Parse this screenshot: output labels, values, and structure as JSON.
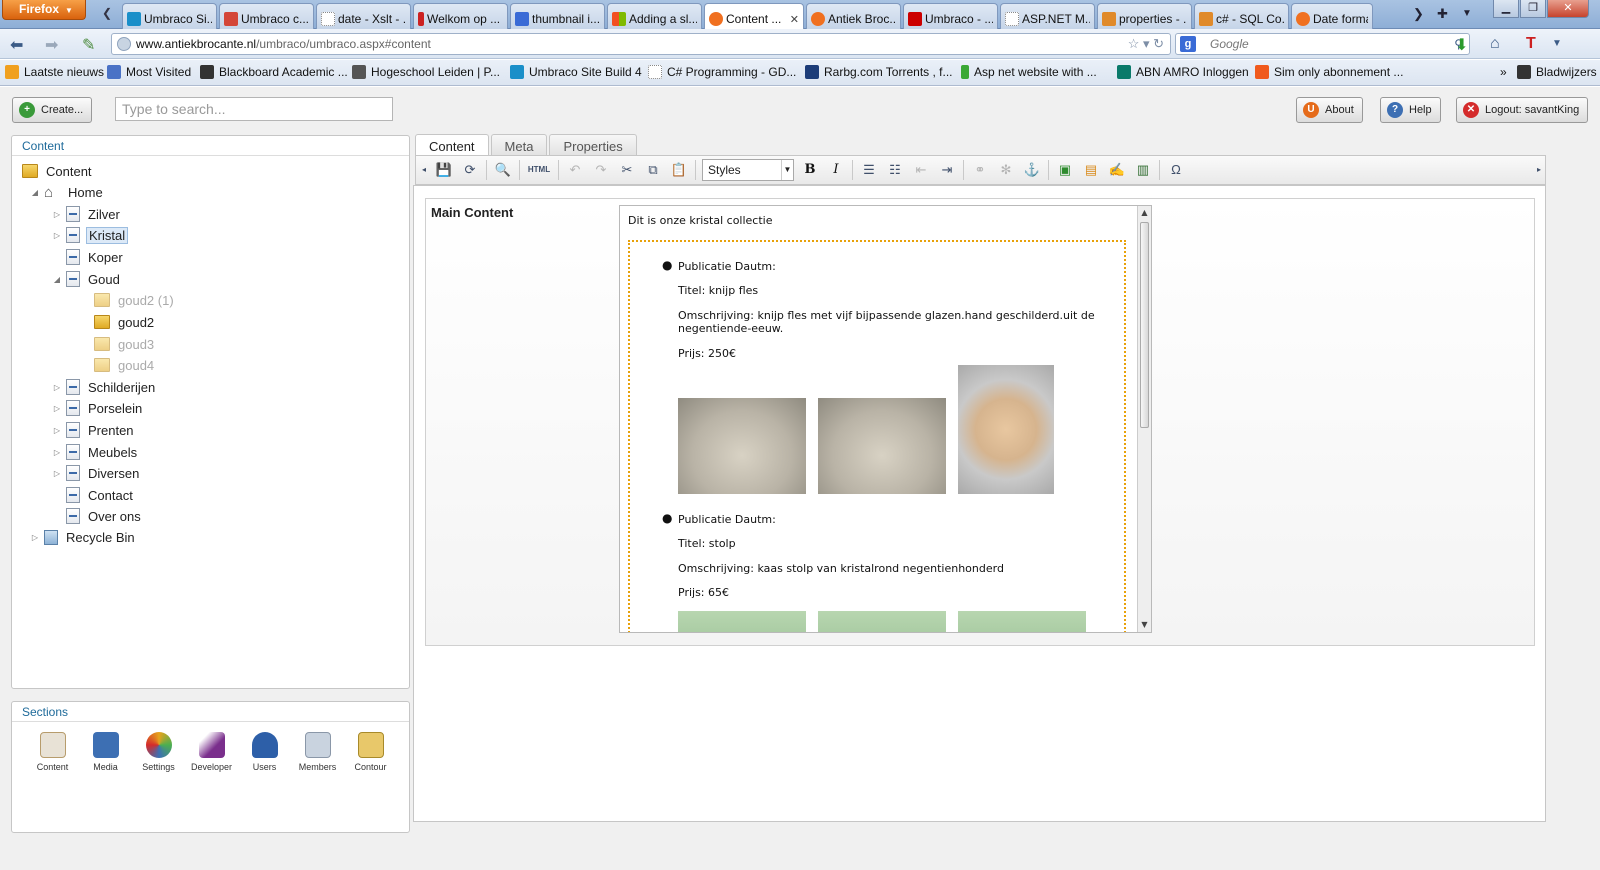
{
  "browser": {
    "menu_label": "Firefox",
    "tabs": [
      {
        "label": "Umbraco Si...",
        "color": "#1a8fc9"
      },
      {
        "label": "Umbraco c...",
        "color": "#d44638"
      },
      {
        "label": "date - Xslt - ...",
        "color": "#bbbbbb"
      },
      {
        "label": "Welkom op ...",
        "color": "#cc2222"
      },
      {
        "label": "thumbnail i...",
        "color": "#3a6bd6"
      },
      {
        "label": "Adding a sl...",
        "color": "#f25022"
      },
      {
        "label": "Content ...",
        "color": "#f07020",
        "active": true
      },
      {
        "label": "Antiek Broc...",
        "color": "#f07020"
      },
      {
        "label": "Umbraco - ...",
        "color": "#cc0000"
      },
      {
        "label": "ASP.NET M...",
        "color": "#bbbbbb"
      },
      {
        "label": "properties - ...",
        "color": "#e08a2a"
      },
      {
        "label": "c# - SQL Co...",
        "color": "#e08a2a"
      },
      {
        "label": "Date format",
        "color": "#f07020"
      }
    ],
    "url_host": "www.antiekbrocante.nl",
    "url_path": "/umbraco/umbraco.aspx#content",
    "search_placeholder": "Google",
    "bookmarks": [
      {
        "label": "Laatste nieuws",
        "color": "#f0a020"
      },
      {
        "label": "Most Visited",
        "color": "#4a72c6"
      },
      {
        "label": "Blackboard Academic ...",
        "color": "#333333"
      },
      {
        "label": "Hogeschool Leiden | P...",
        "color": "#555555"
      },
      {
        "label": "Umbraco Site Build 4",
        "color": "#1a8fc9"
      },
      {
        "label": "C# Programming - GD...",
        "color": "#bbbbbb"
      },
      {
        "label": "Rarbg.com Torrents , f...",
        "color": "#1c3c78"
      },
      {
        "label": "Asp net website with ...",
        "color": "#3aa836"
      },
      {
        "label": "ABN AMRO Inloggen",
        "color": "#0a7a6a"
      },
      {
        "label": "Sim only abonnement ...",
        "color": "#f05a1e"
      }
    ],
    "bookmarks_menu": "Bladwijzers"
  },
  "umbraco": {
    "create_label": "Create...",
    "search_placeholder": "Type to search...",
    "about_label": "About",
    "help_label": "Help",
    "logout_label": "Logout: savantKing",
    "content_panel_title": "Content",
    "tree": {
      "root": "Content",
      "home": "Home",
      "zilver": "Zilver",
      "kristal": "Kristal",
      "koper": "Koper",
      "goud": "Goud",
      "goud2_1": "goud2 (1)",
      "goud2": "goud2",
      "goud3": "goud3",
      "goud4": "goud4",
      "schilderijen": "Schilderijen",
      "porselein": "Porselein",
      "prenten": "Prenten",
      "meubels": "Meubels",
      "diversen": "Diversen",
      "contact": "Contact",
      "over_ons": "Over ons",
      "recycle_bin": "Recycle Bin"
    },
    "sections_title": "Sections",
    "sections": [
      {
        "label": "Content",
        "color": "#e8e2d6"
      },
      {
        "label": "Media",
        "color": "#3d6fb3"
      },
      {
        "label": "Settings",
        "color": "#e6a31c"
      },
      {
        "label": "Developer",
        "color": "#7a2f8c"
      },
      {
        "label": "Users",
        "color": "#2d5fa8"
      },
      {
        "label": "Members",
        "color": "#c9d3df"
      },
      {
        "label": "Contour",
        "color": "#e8c86a"
      }
    ],
    "editor_tabs": [
      "Content",
      "Meta",
      "Properties"
    ],
    "styles_label": "Styles",
    "property_label": "Main Content",
    "rte": {
      "intro": "Dit is onze kristal collectie",
      "items": [
        {
          "date": "Publicatie Dautm:",
          "title": "Titel: knijp fles",
          "description": "Omschrijving:  knijp fles met vijf bijpassende glazen.hand geschilderd.uit de negentiende-eeuw.",
          "price": "Prijs: 250€"
        },
        {
          "date": "Publicatie Dautm:",
          "title": "Titel: stolp",
          "description": "Omschrijving:  kaas stolp van kristalrond negentienhonderd",
          "price": "Prijs: 65€"
        }
      ]
    }
  }
}
